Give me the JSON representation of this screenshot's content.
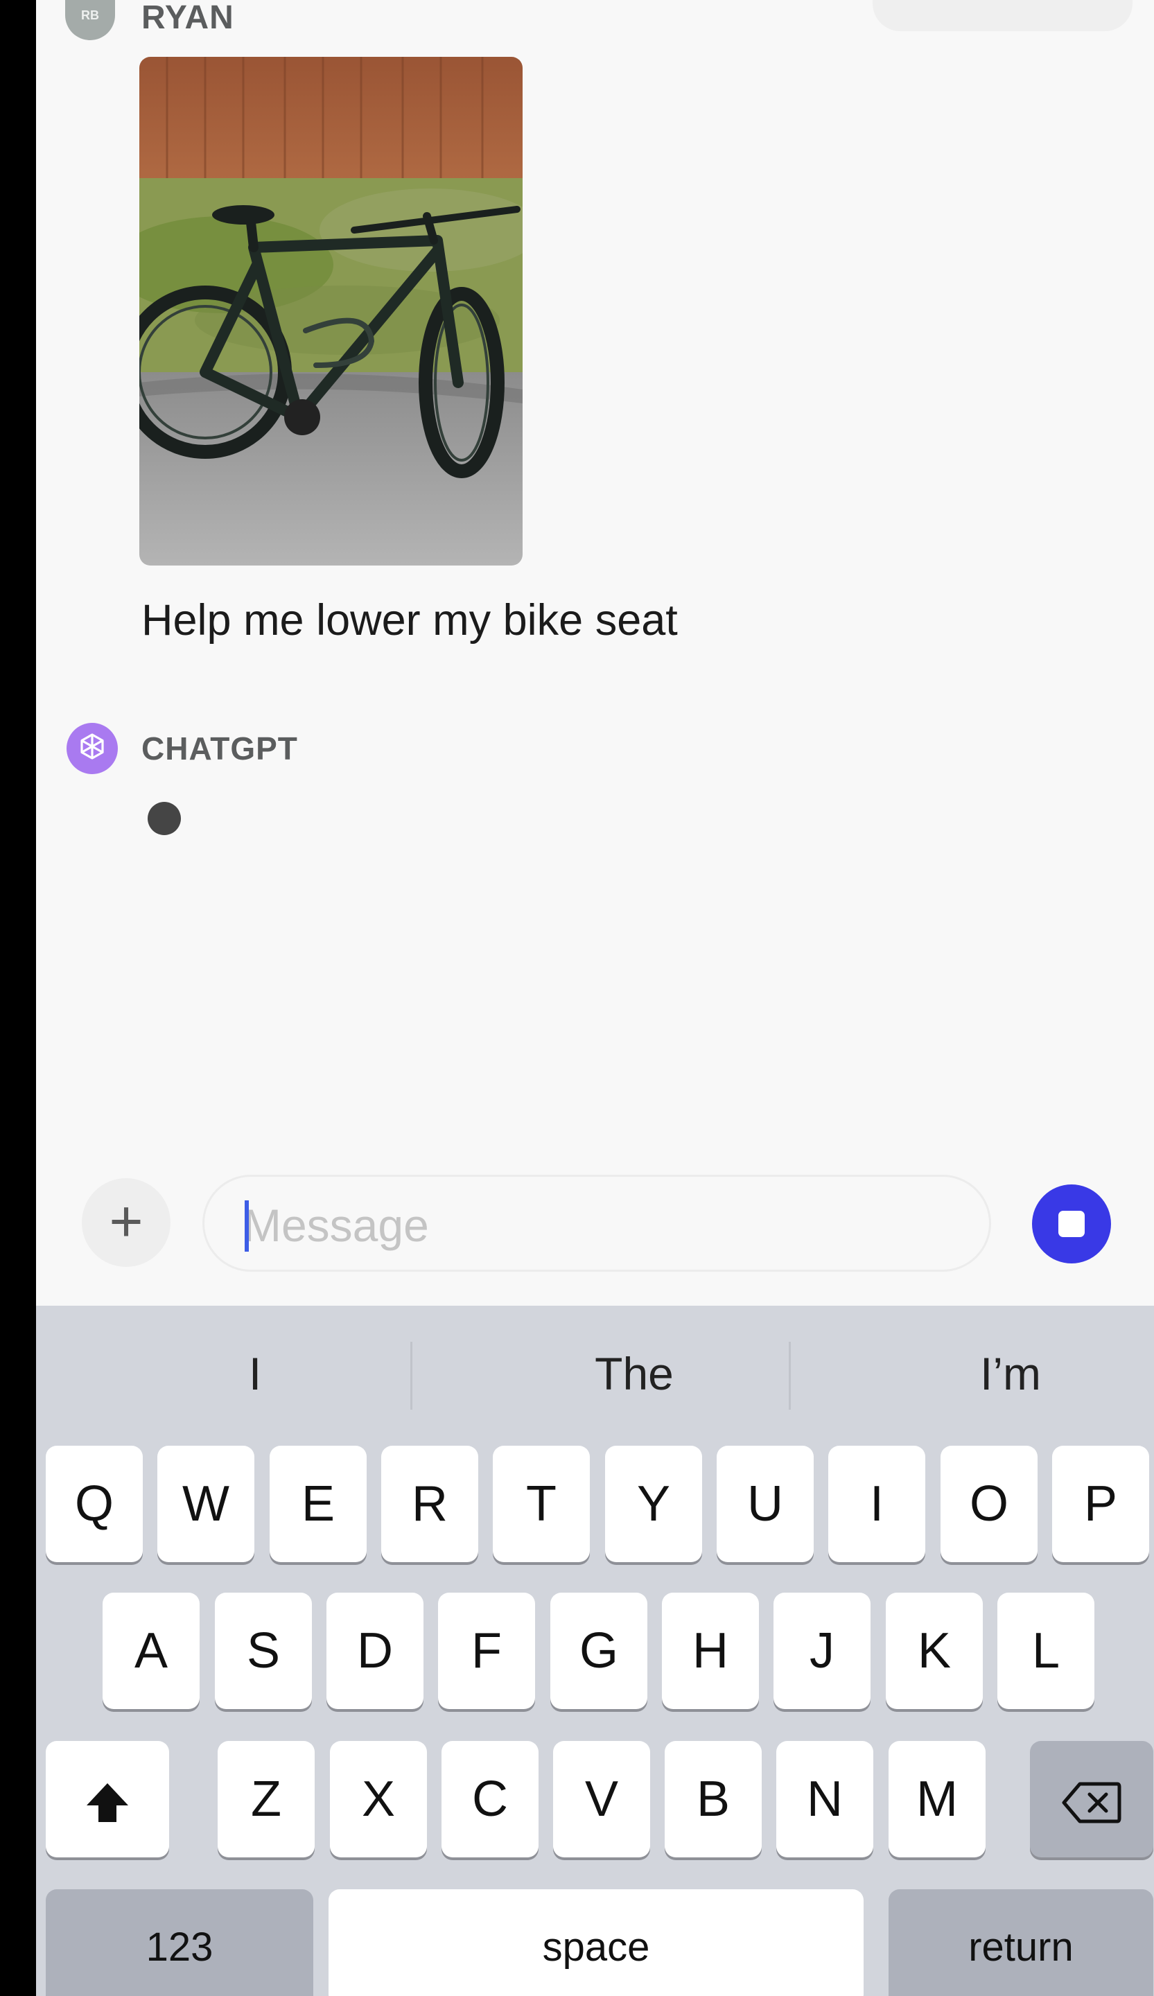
{
  "chat": {
    "user": {
      "initials": "RB",
      "name": "RYAN",
      "message": "Help me lower my bike seat"
    },
    "assistant": {
      "name": "CHATGPT"
    }
  },
  "composer": {
    "placeholder": "Message"
  },
  "keyboard": {
    "suggestions": [
      "I",
      "The",
      "I’m"
    ],
    "row1": [
      "Q",
      "W",
      "E",
      "R",
      "T",
      "Y",
      "U",
      "I",
      "O",
      "P"
    ],
    "row2": [
      "A",
      "S",
      "D",
      "F",
      "G",
      "H",
      "J",
      "K",
      "L"
    ],
    "row3": [
      "Z",
      "X",
      "C",
      "V",
      "B",
      "N",
      "M"
    ],
    "numbers_label": "123",
    "space_label": "space",
    "return_label": "return"
  },
  "colors": {
    "accent": "#3939e6",
    "assistant_avatar": "#a97af0",
    "keyboard_bg": "#d2d5dc"
  },
  "icons": {
    "attach": "plus-icon",
    "stop": "stop-icon",
    "shift": "shift-icon",
    "delete": "backspace-icon",
    "assistant": "openai-logo-icon"
  }
}
